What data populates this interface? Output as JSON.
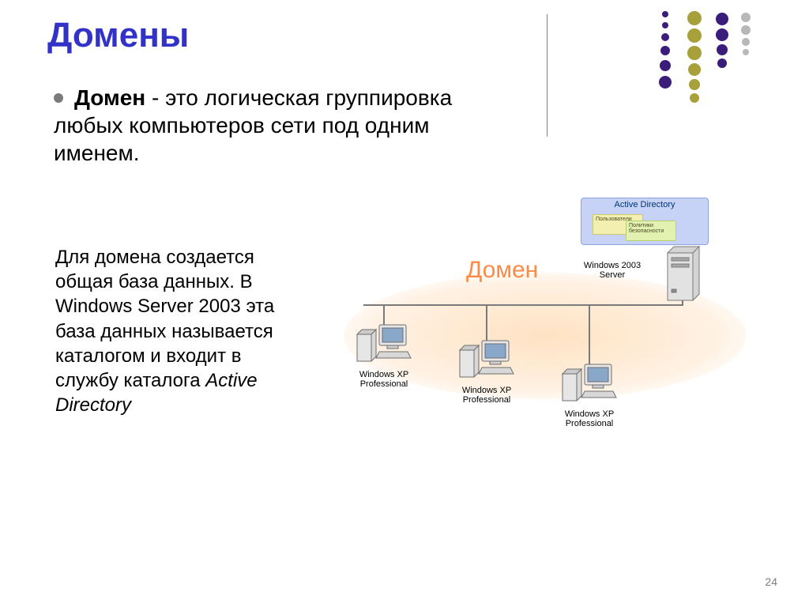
{
  "title": "Домены",
  "bullet": {
    "strong": "Домен",
    "rest": " - это логическая группировка любых компьютеров сети под одним именем."
  },
  "para": {
    "text": "Для домена создается общая база данных. В Windows Server 2003 эта база данных называется каталогом и входит в службу каталога ",
    "italic": "Active Directory"
  },
  "diagram": {
    "oval_label": "Домен",
    "ad_title": "Active Directory",
    "sticky1": "Пользователи",
    "sticky2": "Политики безопасности",
    "server_label": "Windows 2003 Server",
    "client_label": "Windows XP Professional"
  },
  "page_number": "24",
  "colors": {
    "purple": "#3a1d7a",
    "olive": "#a8a03a",
    "gray": "#b8b8b8"
  }
}
